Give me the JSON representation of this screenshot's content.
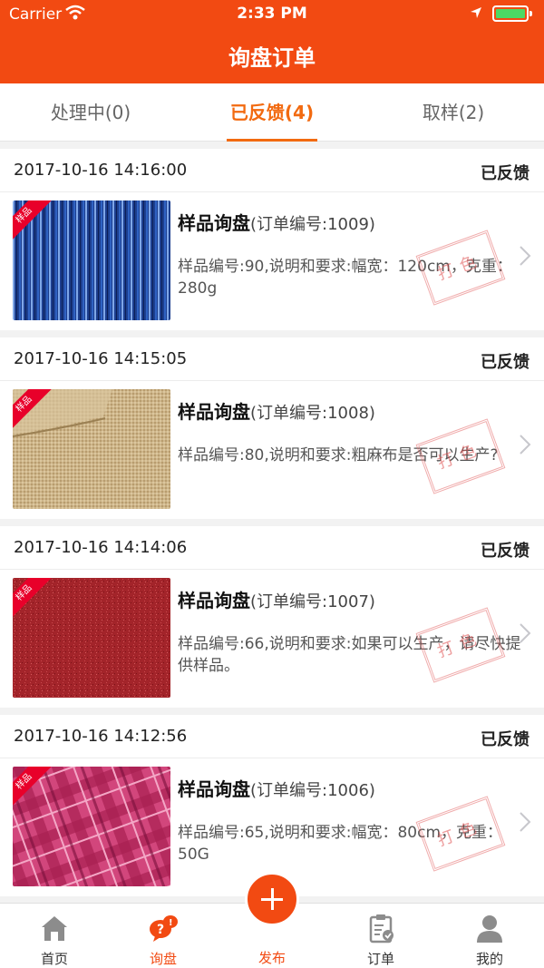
{
  "status_bar": {
    "carrier": "Carrier",
    "time": "2:33 PM"
  },
  "nav": {
    "title": "询盘订单"
  },
  "tabs": [
    {
      "label": "处理中(0)",
      "active": false
    },
    {
      "label": "已反馈(4)",
      "active": true
    },
    {
      "label": "取样(2)",
      "active": false
    }
  ],
  "orders": [
    {
      "datetime": "2017-10-16 14:16:00",
      "status": "已反馈",
      "ribbon": "样品",
      "title": "样品询盘",
      "order_no": "(订单编号:1009)",
      "desc": "样品编号:90,说明和要求:幅宽：120cm，克重：280g",
      "stamp": "打色",
      "swatch": "blue-stripe"
    },
    {
      "datetime": "2017-10-16 14:15:05",
      "status": "已反馈",
      "ribbon": "样品",
      "title": "样品询盘",
      "order_no": "(订单编号:1008)",
      "desc": "样品编号:80,说明和要求:粗麻布是否可以生产?",
      "stamp": "打色",
      "swatch": "burlap"
    },
    {
      "datetime": "2017-10-16 14:14:06",
      "status": "已反馈",
      "ribbon": "样品",
      "title": "样品询盘",
      "order_no": "(订单编号:1007)",
      "desc": "样品编号:66,说明和要求:如果可以生产，请尽快提供样品。",
      "stamp": "打色",
      "swatch": "red-felt"
    },
    {
      "datetime": "2017-10-16 14:12:56",
      "status": "已反馈",
      "ribbon": "样品",
      "title": "样品询盘",
      "order_no": "(订单编号:1006)",
      "desc": "样品编号:65,说明和要求:幅宽：80cm，克重：50G",
      "stamp": "打色",
      "swatch": "pink-plaid"
    }
  ],
  "tabbar": [
    {
      "label": "首页",
      "icon": "home-icon",
      "active": false
    },
    {
      "label": "询盘",
      "icon": "inquiry-icon",
      "active": true
    },
    {
      "label": "发布",
      "icon": "plus-icon",
      "active": false
    },
    {
      "label": "订单",
      "icon": "clipboard-icon",
      "active": false
    },
    {
      "label": "我的",
      "icon": "user-icon",
      "active": false
    }
  ],
  "colors": {
    "brand": "#f24a12",
    "active_tab": "#f26a10",
    "ribbon": "#e8002a"
  }
}
